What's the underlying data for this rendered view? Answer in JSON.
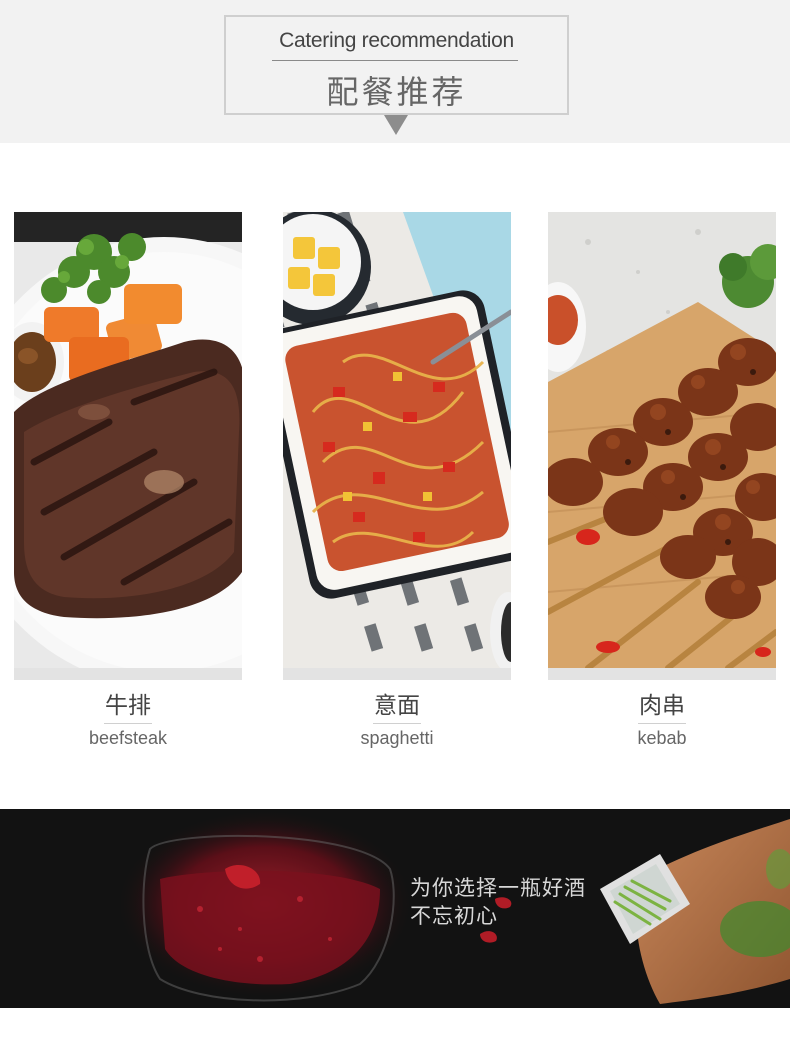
{
  "header": {
    "title_en": "Catering recommendation",
    "title_cn": "配餐推荐"
  },
  "dishes": [
    {
      "name_cn": "牛排",
      "name_en": "beefsteak",
      "image": "beefsteak-photo"
    },
    {
      "name_cn": "意面",
      "name_en": "spaghetti",
      "image": "spaghetti-photo"
    },
    {
      "name_cn": "肉串",
      "name_en": "kebab",
      "image": "kebab-photo"
    }
  ],
  "banner": {
    "line1": "为你选择一瓶好酒",
    "line2": "不忘初心"
  },
  "colors": {
    "header_bg": "#f2f2f2",
    "frame_border": "#cfcfcf",
    "arrow": "#8d8d8d",
    "banner_bg": "#111111"
  }
}
